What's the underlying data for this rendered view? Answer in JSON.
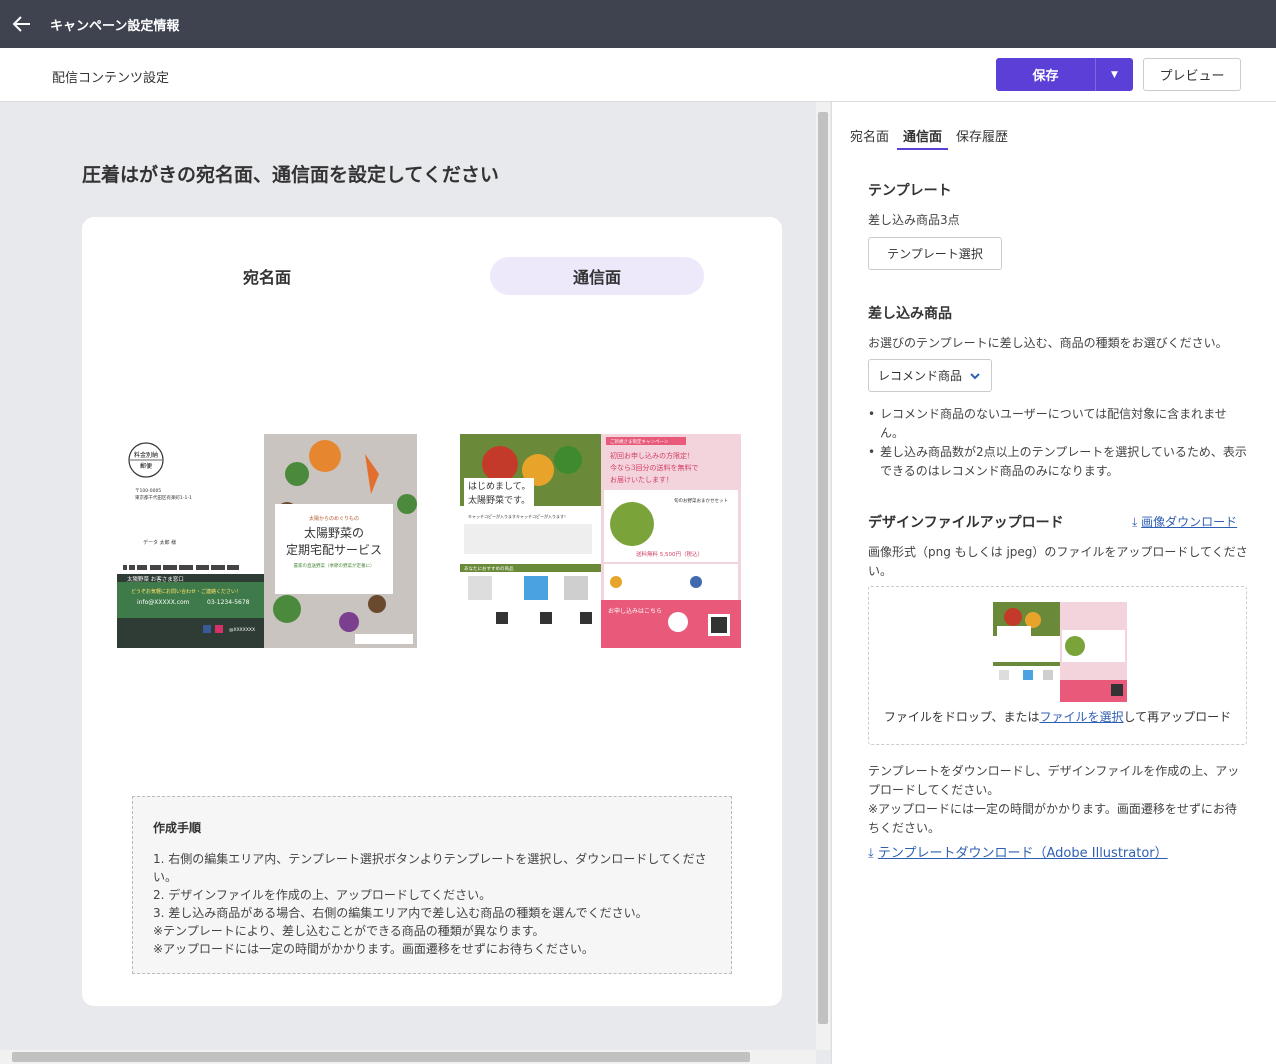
{
  "topbar": {
    "title": "キャンペーン設定情報"
  },
  "subheader": {
    "title": "配信コンテンツ設定",
    "save_label": "保存",
    "preview_label": "プレビュー"
  },
  "main": {
    "heading": "圧着はがきの宛名面、通信面を設定してください",
    "tab_address": "宛名面",
    "tab_message": "通信面",
    "steps_title": "作成手順",
    "steps": [
      "1. 右側の編集エリア内、テンプレート選択ボタンよりテンプレートを選択し、ダウンロードしてください。",
      "2. デザインファイルを作成の上、アップロードしてください。",
      "3. 差し込み商品がある場合、右側の編集エリア内で差し込む商品の種類を選んでください。",
      "※テンプレートにより、差し込むことができる商品の種類が異なります。",
      "※アップロードには一定の時間がかかります。画面遷移をせずにお待ちください。"
    ]
  },
  "postcard_left": {
    "stamp_line1": "料金別納",
    "stamp_line2": "郵便",
    "address_line1": "〒100-0005",
    "address_line2": "東京都千代田区有楽町1-1-1",
    "recipient": "データ 太郎 様",
    "company": "太陽野菜 お客さま窓口",
    "contact_note": "どうぞお気軽にお問い合わせ・ご連絡ください！",
    "email": "info@XXXXX.com",
    "phone": "03-1234-5678",
    "social": "@XXXXXXX",
    "cover_sub": "太陽からのめぐりもの",
    "cover_title1": "太陽野菜の",
    "cover_title2": "定期宅配サービス",
    "cover_note": "農家の直送野菜（季節の野菜が定番に）"
  },
  "postcard_right": {
    "greeting1": "はじめまして。",
    "greeting2": "太陽野菜です。",
    "catch": "キャッチコピーが入りますキャッチコピーが入ります！",
    "campaign_tag": "ご新規さま限定キャンペーン",
    "campaign1": "初回お申し込みの方限定！",
    "campaign2": "今なら3回分の送料を無料で",
    "campaign3": "お届けいたします！",
    "set_title": "旬のお野菜おまかせセット",
    "price": "送料無料 5,500円（税込）",
    "recommend_title": "あなたにおすすめの商品",
    "apply_title": "お申し込みはこちら"
  },
  "panel": {
    "tabs": [
      "宛名面",
      "通信面",
      "保存履歴"
    ],
    "active_tab": "通信面",
    "template_heading": "テンプレート",
    "template_desc": "差し込み商品3点",
    "template_button": "テンプレート選択",
    "insert_heading": "差し込み商品",
    "insert_desc": "お選びのテンプレートに差し込む、商品の種類をお選びください。",
    "insert_select": "レコメンド商品",
    "notes": [
      "レコメンド商品のないユーザーについては配信対象に含まれません。",
      "差し込み商品数が2点以上のテンプレートを選択しているため、表示できるのはレコメンド商品のみになります。"
    ],
    "upload_heading": "デザインファイルアップロード",
    "image_download": "画像ダウンロード",
    "upload_desc": "画像形式（png もしくは jpeg）のファイルをアップロードしてください。",
    "drop_prefix": "ファイルをドロップ、または",
    "drop_link": "ファイルを選択",
    "drop_suffix": "して再アップロード",
    "template_note1": "テンプレートをダウンロードし、デザインファイルを作成の上、アップロードしてください。",
    "template_note2": "※アップロードには一定の時間がかかります。画面遷移をせずにお待ちください。",
    "template_download": "テンプレートダウンロード（Adobe Illustrator）"
  },
  "colors": {
    "primary": "#5b3fd6",
    "topbar": "#3f4350",
    "link": "#2f5fb3",
    "tab_active_bg": "#ede9fb"
  },
  "icons": [
    "back-arrow-icon",
    "chevron-down-icon",
    "download-icon"
  ]
}
